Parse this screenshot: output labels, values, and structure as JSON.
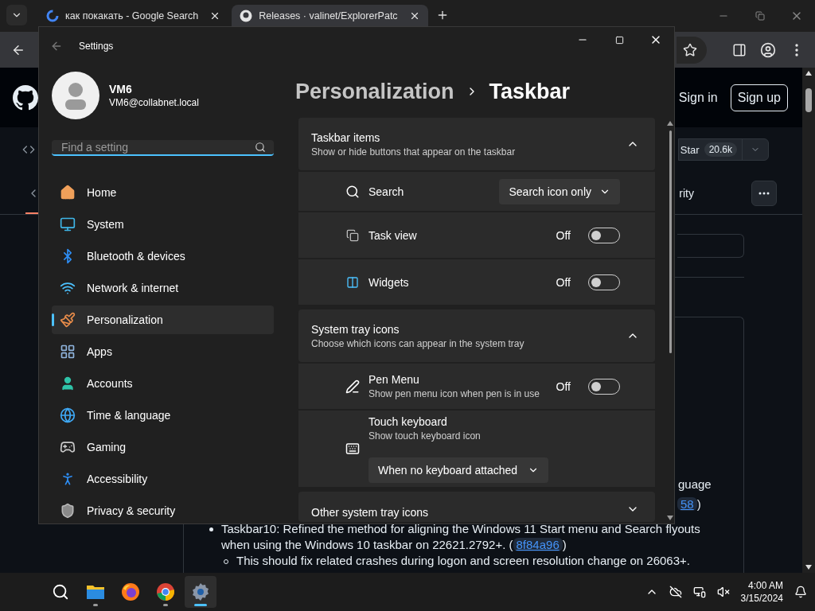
{
  "browser": {
    "tabs": [
      {
        "title": "как покакать - Google Search",
        "selected": false
      },
      {
        "title": "Releases · valinet/ExplorerPatc",
        "selected": true
      }
    ],
    "github": {
      "sign_in": "Sign in",
      "sign_up": "Sign up",
      "star": "Star",
      "star_count": "20.6k",
      "nav_partial": "rity",
      "release": {
        "partial_line": "guage",
        "partial_link": {
          "link": "58",
          "after": ")"
        },
        "bullets": [
          {
            "text": "Taskbar10: Refined the method for aligning the Windows 11 Start menu and Search flyouts when using the Windows 10 taskbar on 22621.2792+. (",
            "link": "8f84a96",
            "after": ")",
            "children": [
              {
                "text": "This should fix related crashes during logon and screen resolution change on 26063+."
              }
            ]
          }
        ]
      }
    }
  },
  "settings": {
    "title": "Settings",
    "user": {
      "name": "VM6",
      "email": "VM6@collabnet.local"
    },
    "search": {
      "placeholder": "Find a setting"
    },
    "nav": [
      {
        "label": "Home",
        "selected": false
      },
      {
        "label": "System",
        "selected": false
      },
      {
        "label": "Bluetooth & devices",
        "selected": false
      },
      {
        "label": "Network & internet",
        "selected": false
      },
      {
        "label": "Personalization",
        "selected": true
      },
      {
        "label": "Apps",
        "selected": false
      },
      {
        "label": "Accounts",
        "selected": false
      },
      {
        "label": "Time & language",
        "selected": false
      },
      {
        "label": "Gaming",
        "selected": false
      },
      {
        "label": "Accessibility",
        "selected": false
      },
      {
        "label": "Privacy & security",
        "selected": false
      }
    ],
    "breadcrumb": {
      "parent": "Personalization",
      "current": "Taskbar"
    },
    "sections": [
      {
        "title": "Taskbar items",
        "subtitle": "Show or hide buttons that appear on the taskbar",
        "expanded": true,
        "rows": [
          {
            "kind": "dropdown",
            "label": "Search",
            "value": "Search icon only"
          },
          {
            "kind": "toggle",
            "label": "Task view",
            "state_text": "Off",
            "on": false
          },
          {
            "kind": "toggle",
            "label": "Widgets",
            "state_text": "Off",
            "on": false
          }
        ]
      },
      {
        "title": "System tray icons",
        "subtitle": "Choose which icons can appear in the system tray",
        "expanded": true,
        "rows": [
          {
            "kind": "toggle",
            "label": "Pen Menu",
            "description": "Show pen menu icon when pen is in use",
            "state_text": "Off",
            "on": false
          },
          {
            "kind": "dropdown_below",
            "label": "Touch keyboard",
            "description": "Show touch keyboard icon",
            "value": "When no keyboard attached"
          }
        ]
      },
      {
        "title": "Other system tray icons",
        "expanded": false
      }
    ]
  },
  "taskbar": {
    "apps": [
      {
        "running": false,
        "selected": false
      },
      {
        "running": true,
        "selected": false
      },
      {
        "running": false,
        "selected": false
      },
      {
        "running": true,
        "selected": false
      },
      {
        "running": true,
        "selected": true
      }
    ],
    "time": "4:00 AM",
    "date": "3/15/2024"
  }
}
